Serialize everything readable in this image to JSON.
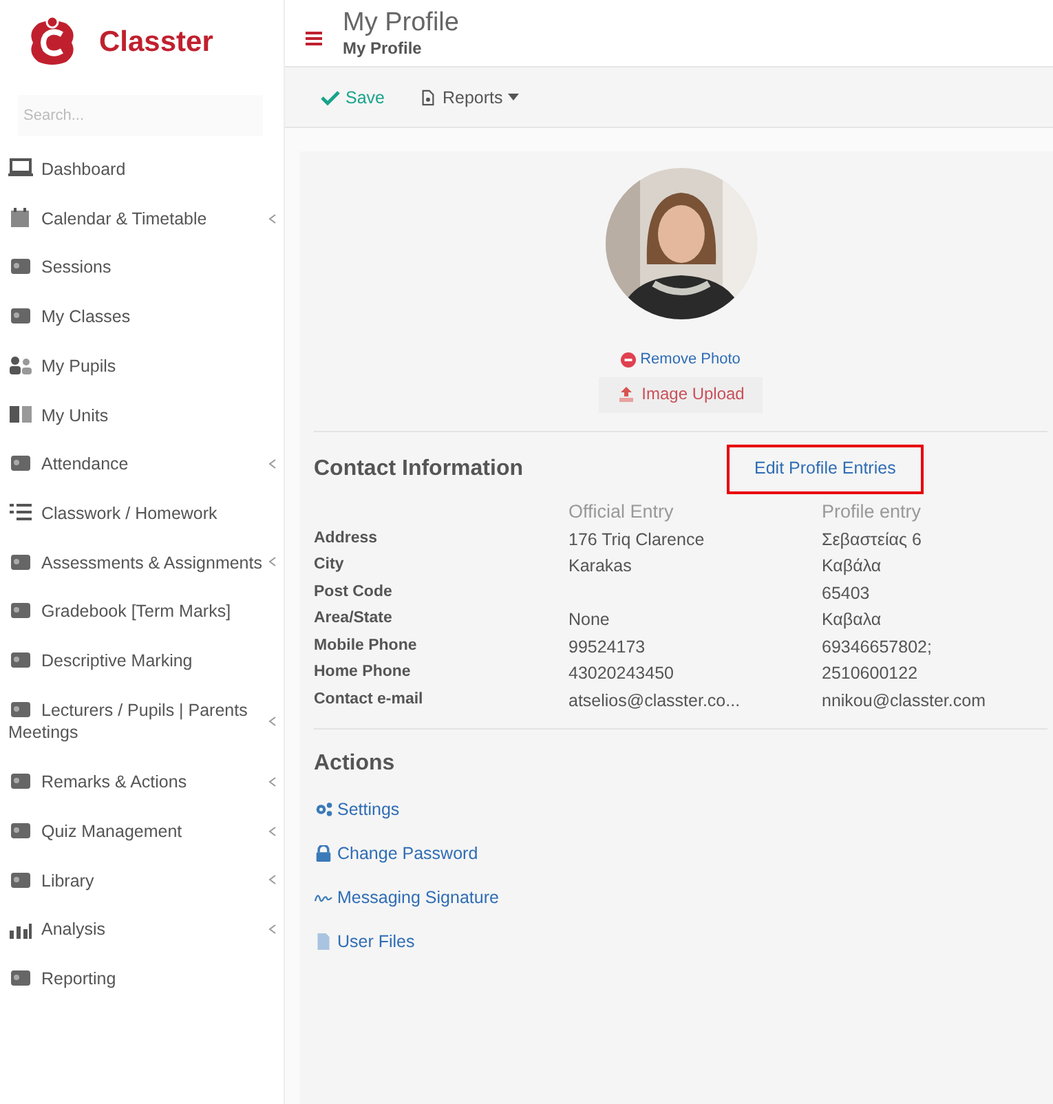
{
  "brand": {
    "name": "Classter"
  },
  "search": {
    "placeholder": "Search..."
  },
  "sidebar": {
    "items": [
      {
        "label": "Dashboard",
        "has_submenu": false
      },
      {
        "label": "Calendar & Timetable",
        "has_submenu": true
      },
      {
        "label": "Sessions",
        "has_submenu": false
      },
      {
        "label": "My Classes",
        "has_submenu": false
      },
      {
        "label": "My Pupils",
        "has_submenu": false
      },
      {
        "label": "My Units",
        "has_submenu": false
      },
      {
        "label": "Attendance",
        "has_submenu": true
      },
      {
        "label": "Classwork / Homework",
        "has_submenu": false
      },
      {
        "label": "Assessments & Assignments",
        "has_submenu": true
      },
      {
        "label": "Gradebook [Term Marks]",
        "has_submenu": false
      },
      {
        "label": "Descriptive Marking",
        "has_submenu": false
      },
      {
        "label": "Lecturers / Pupils | Parents Meetings",
        "has_submenu": true
      },
      {
        "label": "Remarks & Actions",
        "has_submenu": true
      },
      {
        "label": "Quiz Management",
        "has_submenu": true
      },
      {
        "label": "Library",
        "has_submenu": true
      },
      {
        "label": "Analysis",
        "has_submenu": true
      },
      {
        "label": "Reporting",
        "has_submenu": false
      }
    ]
  },
  "header": {
    "title": "My Profile",
    "breadcrumb": "My Profile"
  },
  "toolbar": {
    "save": "Save",
    "reports": "Reports"
  },
  "profile": {
    "remove_photo": "Remove Photo",
    "image_upload": "Image Upload"
  },
  "contact": {
    "title": "Contact Information",
    "edit_link": "Edit Profile Entries",
    "edit_highlighted": true,
    "columns": [
      "Official Entry",
      "Profile entry"
    ],
    "rows": [
      {
        "label": "Address",
        "official": "176 Triq Clarence",
        "profile": "Σεβαστείας 6"
      },
      {
        "label": "City",
        "official": "Karakas",
        "profile": "Καβάλα"
      },
      {
        "label": "Post Code",
        "profile": "65403"
      },
      {
        "label": "Area/State",
        "official": "None",
        "profile": "Καβαλα"
      },
      {
        "label": "Mobile Phone",
        "official": "99524173",
        "profile": "69346657802;"
      },
      {
        "label": "Home Phone",
        "official": "43020243450",
        "profile": "2510600122"
      },
      {
        "label": "Contact e-mail",
        "official": "atselios@classter.co...",
        "profile": "nnikou@classter.com"
      }
    ]
  },
  "actions": {
    "title": "Actions",
    "links": [
      "Settings",
      "Change Password",
      "Messaging Signature",
      "User Files"
    ]
  }
}
